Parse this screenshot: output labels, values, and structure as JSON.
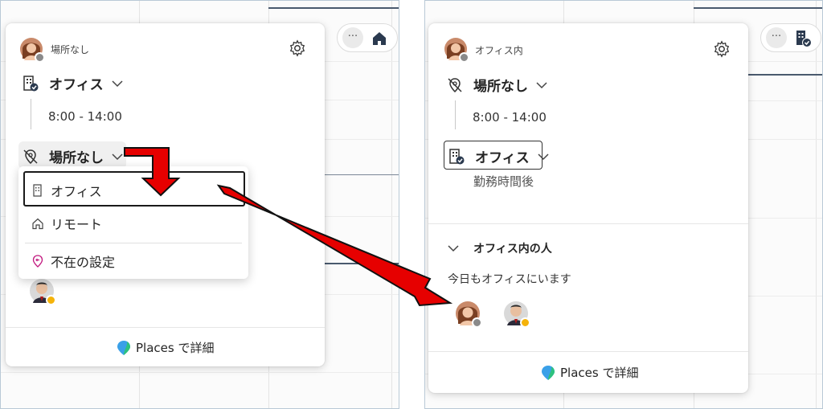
{
  "left_panel": {
    "status_small": "場所なし",
    "current_location": "オフィス",
    "time_range": "8:00 - 14:00",
    "selector_label": "場所なし",
    "menu": {
      "items": [
        {
          "label": "オフィス",
          "icon": "building-icon"
        },
        {
          "label": "リモート",
          "icon": "home-icon"
        },
        {
          "label": "不在の設定",
          "icon": "away-icon"
        }
      ]
    },
    "places_link": "Places で詳細",
    "pill_more": "···"
  },
  "right_panel": {
    "status_small": "オフィス内",
    "current_location": "場所なし",
    "time_range": "8:00 - 14:00",
    "selected_location": "オフィス",
    "after_hours_note": "勤務時間後",
    "section_title": "オフィス内の人",
    "today_note": "今日もオフィスにいます",
    "places_link": "Places で詳細",
    "pill_more": "···"
  },
  "colors": {
    "annotation_arrow": "#e60000",
    "accent_dark": "#2b3a4f"
  }
}
